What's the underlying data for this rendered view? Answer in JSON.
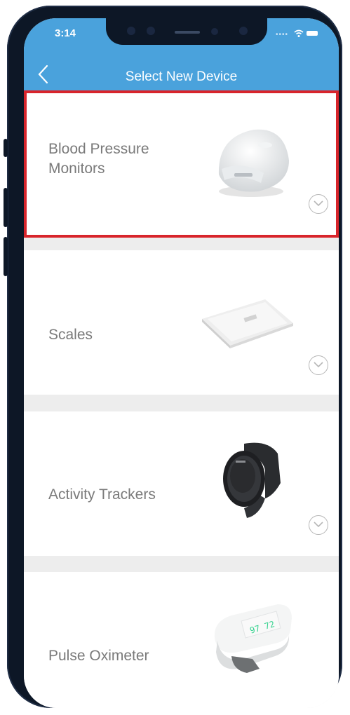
{
  "status_bar": {
    "time": "3:14"
  },
  "header": {
    "title": "Select New Device"
  },
  "devices": [
    {
      "label_line1": "Blood Pressure",
      "label_line2": "Monitors",
      "selected": true,
      "icon": "blood-pressure-monitor-icon"
    },
    {
      "label_line1": "Scales",
      "label_line2": "",
      "selected": false,
      "icon": "scale-icon"
    },
    {
      "label_line1": "Activity Trackers",
      "label_line2": "",
      "selected": false,
      "icon": "activity-tracker-icon"
    },
    {
      "label_line1": "Pulse Oximeter",
      "label_line2": "",
      "selected": false,
      "icon": "pulse-oximeter-icon"
    }
  ],
  "colors": {
    "header_blue": "#4aa2dc",
    "selection_red": "#d8242b",
    "background_gray": "#ededed"
  }
}
